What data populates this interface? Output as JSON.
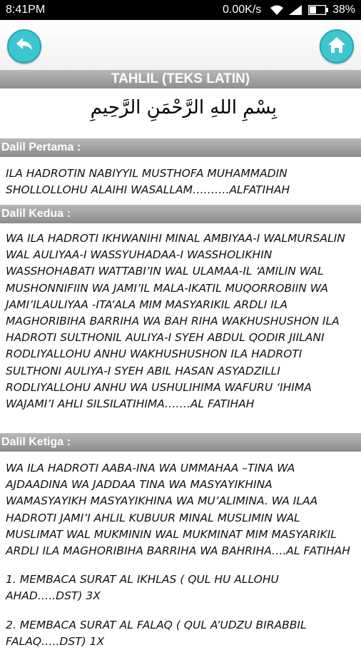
{
  "status_bar": {
    "time": "8:41PM",
    "network_speed": "0.00K/s",
    "battery_percent": "38%"
  },
  "header": {
    "title": "TAHLIL (TEKS LATIN)",
    "bismillah": "بِسْمِ اللهِ الرَّحْمَنِ الرَّحِيمِ"
  },
  "colors": {
    "button_accent": "#3cc7d0",
    "header_bar": "#9e9e9e"
  },
  "sections": [
    {
      "heading": "Dalil Pertama :",
      "paragraphs": [
        "ILA HADROTIN NABIYYIL MUSTHOFA MUHAMMADIN SHOLLOLLOHU ALAIHI WASALLAM……….ALFATIHAH"
      ]
    },
    {
      "heading": "Dalil Kedua :",
      "paragraphs": [
        "WA ILA HADROTI IKHWANIHI MINAL AMBIYAA-I WALMURSALIN WAL AULIYAA-I WASSYUHADAA-I WASSHOLIKHIN WASSHOHABATI WATTABI’IN WAL ULAMAA-IL ‘AMILIN WAL MUSHONNIFIIN WA JAMI’IL MALA-IKATIL MUQORROBIIN WA JAMI’ILAULIYAA -ITA’ALA MIM MASYARIKIL ARDLI ILA MAGHORIBIHA BARRIHA WA BAH RIHA WAKHUSHUSHON ILA HADROTI SULTHONIL AULIYA-I SYEH ABDUL QODIR JIILANI RODLIYALLOHU ANHU WAKHUSHUSHON ILA HADROTI SULTHONI AULIYA-I SYEH ABIL HASAN ASYADZILLI RODLIYALLOHU ANHU WA USHULIHIMA WAFURU ‘IHIMA WAJAMI’I AHLI SILSILATIHIMA…….AL FATIHAH"
      ]
    },
    {
      "heading": "Dalil Ketiga :",
      "paragraphs": [
        "WA ILA HADROTI AABA-INA WA UMMAHAA –TINA WA AJDAADINA  WA JADDAA TINA WA MASYAYIKHINA WAMASYAYIKH MASYAYIKHINA WA MU’ALIMINA. WA ILAA HADROTI JAMI’I AHLIL KUBUUR MINAL MUSLIMIN WAL MUSLIMAT WAL MUKMININ WAL MUKMINAT MIM MASYARIKIL ARDLI ILA MAGHORIBIHA BARRIHA WA BAHRIHA….AL FATIHAH",
        "1. MEMBACA SURAT AL IKHLAS ( QUL HU ALLOHU AHAD…..DST) 3X",
        "2. MEMBACA SURAT AL FALAQ ( QUL A’UDZU BIRABBIL FALAQ…..DST) 1X"
      ]
    }
  ]
}
